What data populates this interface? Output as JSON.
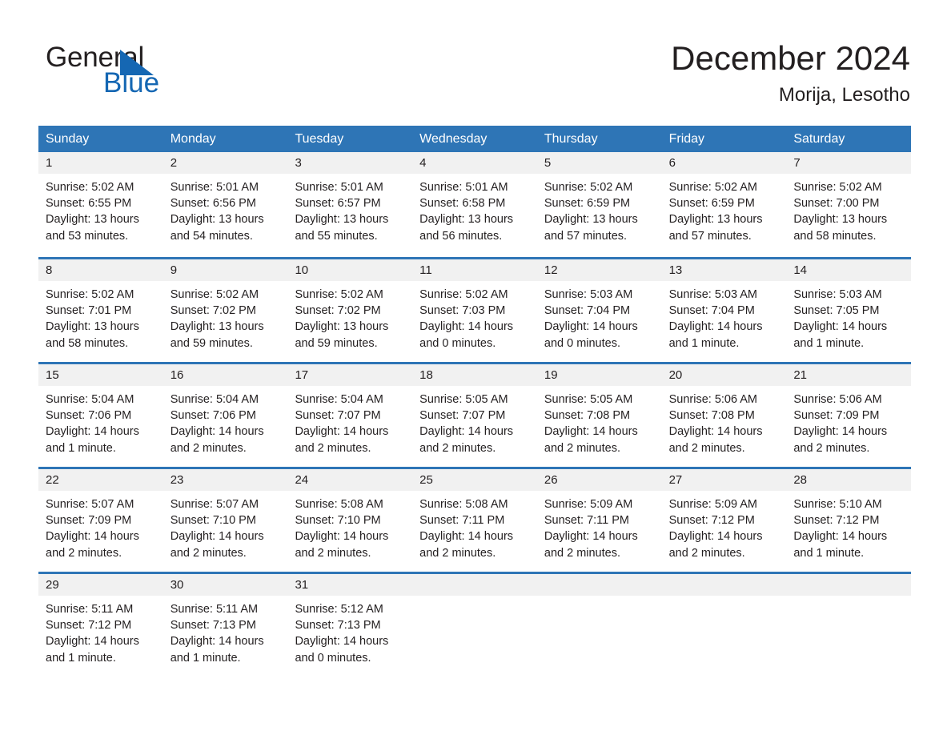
{
  "brand": {
    "name_top": "General",
    "name_bottom": "Blue",
    "accent_color": "#1567b3"
  },
  "header": {
    "title": "December 2024",
    "location": "Morija, Lesotho"
  },
  "calendar": {
    "header_bg": "#2e75b6",
    "daynum_bg": "#f1f1f1",
    "weekdays": [
      "Sunday",
      "Monday",
      "Tuesday",
      "Wednesday",
      "Thursday",
      "Friday",
      "Saturday"
    ],
    "weeks": [
      [
        {
          "day": "1",
          "sunrise": "Sunrise: 5:02 AM",
          "sunset": "Sunset: 6:55 PM",
          "daylight": "Daylight: 13 hours and 53 minutes."
        },
        {
          "day": "2",
          "sunrise": "Sunrise: 5:01 AM",
          "sunset": "Sunset: 6:56 PM",
          "daylight": "Daylight: 13 hours and 54 minutes."
        },
        {
          "day": "3",
          "sunrise": "Sunrise: 5:01 AM",
          "sunset": "Sunset: 6:57 PM",
          "daylight": "Daylight: 13 hours and 55 minutes."
        },
        {
          "day": "4",
          "sunrise": "Sunrise: 5:01 AM",
          "sunset": "Sunset: 6:58 PM",
          "daylight": "Daylight: 13 hours and 56 minutes."
        },
        {
          "day": "5",
          "sunrise": "Sunrise: 5:02 AM",
          "sunset": "Sunset: 6:59 PM",
          "daylight": "Daylight: 13 hours and 57 minutes."
        },
        {
          "day": "6",
          "sunrise": "Sunrise: 5:02 AM",
          "sunset": "Sunset: 6:59 PM",
          "daylight": "Daylight: 13 hours and 57 minutes."
        },
        {
          "day": "7",
          "sunrise": "Sunrise: 5:02 AM",
          "sunset": "Sunset: 7:00 PM",
          "daylight": "Daylight: 13 hours and 58 minutes."
        }
      ],
      [
        {
          "day": "8",
          "sunrise": "Sunrise: 5:02 AM",
          "sunset": "Sunset: 7:01 PM",
          "daylight": "Daylight: 13 hours and 58 minutes."
        },
        {
          "day": "9",
          "sunrise": "Sunrise: 5:02 AM",
          "sunset": "Sunset: 7:02 PM",
          "daylight": "Daylight: 13 hours and 59 minutes."
        },
        {
          "day": "10",
          "sunrise": "Sunrise: 5:02 AM",
          "sunset": "Sunset: 7:02 PM",
          "daylight": "Daylight: 13 hours and 59 minutes."
        },
        {
          "day": "11",
          "sunrise": "Sunrise: 5:02 AM",
          "sunset": "Sunset: 7:03 PM",
          "daylight": "Daylight: 14 hours and 0 minutes."
        },
        {
          "day": "12",
          "sunrise": "Sunrise: 5:03 AM",
          "sunset": "Sunset: 7:04 PM",
          "daylight": "Daylight: 14 hours and 0 minutes."
        },
        {
          "day": "13",
          "sunrise": "Sunrise: 5:03 AM",
          "sunset": "Sunset: 7:04 PM",
          "daylight": "Daylight: 14 hours and 1 minute."
        },
        {
          "day": "14",
          "sunrise": "Sunrise: 5:03 AM",
          "sunset": "Sunset: 7:05 PM",
          "daylight": "Daylight: 14 hours and 1 minute."
        }
      ],
      [
        {
          "day": "15",
          "sunrise": "Sunrise: 5:04 AM",
          "sunset": "Sunset: 7:06 PM",
          "daylight": "Daylight: 14 hours and 1 minute."
        },
        {
          "day": "16",
          "sunrise": "Sunrise: 5:04 AM",
          "sunset": "Sunset: 7:06 PM",
          "daylight": "Daylight: 14 hours and 2 minutes."
        },
        {
          "day": "17",
          "sunrise": "Sunrise: 5:04 AM",
          "sunset": "Sunset: 7:07 PM",
          "daylight": "Daylight: 14 hours and 2 minutes."
        },
        {
          "day": "18",
          "sunrise": "Sunrise: 5:05 AM",
          "sunset": "Sunset: 7:07 PM",
          "daylight": "Daylight: 14 hours and 2 minutes."
        },
        {
          "day": "19",
          "sunrise": "Sunrise: 5:05 AM",
          "sunset": "Sunset: 7:08 PM",
          "daylight": "Daylight: 14 hours and 2 minutes."
        },
        {
          "day": "20",
          "sunrise": "Sunrise: 5:06 AM",
          "sunset": "Sunset: 7:08 PM",
          "daylight": "Daylight: 14 hours and 2 minutes."
        },
        {
          "day": "21",
          "sunrise": "Sunrise: 5:06 AM",
          "sunset": "Sunset: 7:09 PM",
          "daylight": "Daylight: 14 hours and 2 minutes."
        }
      ],
      [
        {
          "day": "22",
          "sunrise": "Sunrise: 5:07 AM",
          "sunset": "Sunset: 7:09 PM",
          "daylight": "Daylight: 14 hours and 2 minutes."
        },
        {
          "day": "23",
          "sunrise": "Sunrise: 5:07 AM",
          "sunset": "Sunset: 7:10 PM",
          "daylight": "Daylight: 14 hours and 2 minutes."
        },
        {
          "day": "24",
          "sunrise": "Sunrise: 5:08 AM",
          "sunset": "Sunset: 7:10 PM",
          "daylight": "Daylight: 14 hours and 2 minutes."
        },
        {
          "day": "25",
          "sunrise": "Sunrise: 5:08 AM",
          "sunset": "Sunset: 7:11 PM",
          "daylight": "Daylight: 14 hours and 2 minutes."
        },
        {
          "day": "26",
          "sunrise": "Sunrise: 5:09 AM",
          "sunset": "Sunset: 7:11 PM",
          "daylight": "Daylight: 14 hours and 2 minutes."
        },
        {
          "day": "27",
          "sunrise": "Sunrise: 5:09 AM",
          "sunset": "Sunset: 7:12 PM",
          "daylight": "Daylight: 14 hours and 2 minutes."
        },
        {
          "day": "28",
          "sunrise": "Sunrise: 5:10 AM",
          "sunset": "Sunset: 7:12 PM",
          "daylight": "Daylight: 14 hours and 1 minute."
        }
      ],
      [
        {
          "day": "29",
          "sunrise": "Sunrise: 5:11 AM",
          "sunset": "Sunset: 7:12 PM",
          "daylight": "Daylight: 14 hours and 1 minute."
        },
        {
          "day": "30",
          "sunrise": "Sunrise: 5:11 AM",
          "sunset": "Sunset: 7:13 PM",
          "daylight": "Daylight: 14 hours and 1 minute."
        },
        {
          "day": "31",
          "sunrise": "Sunrise: 5:12 AM",
          "sunset": "Sunset: 7:13 PM",
          "daylight": "Daylight: 14 hours and 0 minutes."
        },
        {
          "day": "",
          "sunrise": "",
          "sunset": "",
          "daylight": ""
        },
        {
          "day": "",
          "sunrise": "",
          "sunset": "",
          "daylight": ""
        },
        {
          "day": "",
          "sunrise": "",
          "sunset": "",
          "daylight": ""
        },
        {
          "day": "",
          "sunrise": "",
          "sunset": "",
          "daylight": ""
        }
      ]
    ]
  }
}
